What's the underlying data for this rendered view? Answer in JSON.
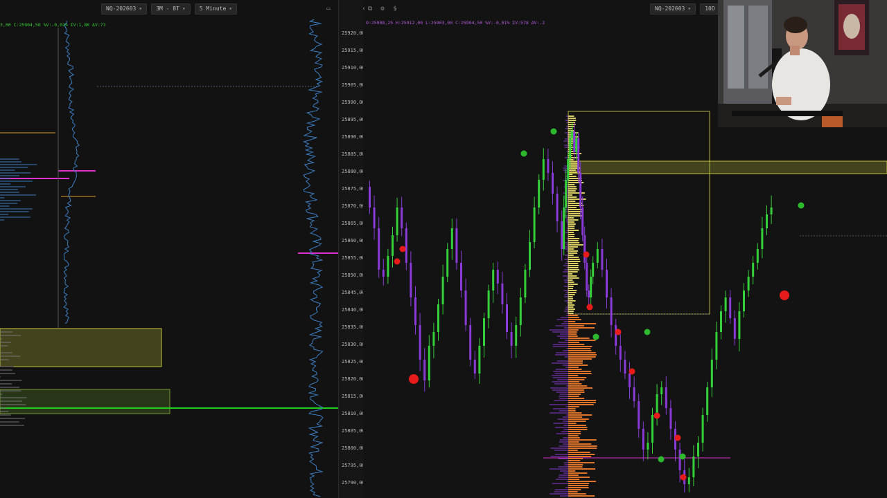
{
  "left_toolbar": {
    "symbol": "NQ-202603",
    "range": "3M - 8T",
    "interval": "5 Minute"
  },
  "left_ohlc": "3,00  C:25904,50  %V:-0,02%  ΣV:1,8K  ΔV:73",
  "right_toolbar": {
    "symbol": "NQ-202603",
    "range": "10D - 8T"
  },
  "right_ohlc": "O:25908,25  H:25912,00  L:25903,00  C:25904,50  %V:-0,01%  ΣV:578  ΔV:-2",
  "price_axis": [
    "25920,00",
    "25915,00",
    "25910,00",
    "25905,00",
    "25900,00",
    "25895,00",
    "25890,00",
    "25885,00",
    "25880,00",
    "25875,00",
    "25870,00",
    "25865,00",
    "25860,00",
    "25855,00",
    "25850,00",
    "25845,00",
    "25840,00",
    "25835,00",
    "25830,00",
    "25825,00",
    "25820,00",
    "25815,00",
    "25810,00",
    "25805,00",
    "25800,00",
    "25795,00",
    "25790,00"
  ],
  "icons": {
    "window": "window-icon",
    "minimize": "minimize-icon",
    "maximize": "maximize-icon",
    "close": "close-icon",
    "compare": "compare-icon",
    "settings": "gear-icon",
    "currency": "dollar-icon"
  },
  "colors": {
    "up": "#35d13a",
    "down": "#8a3ad6",
    "volume_profile": "#3d7fc4",
    "value_area_high": "#d8cc62",
    "value_area_low": "#e0742b",
    "marker_buy": "#2eb82e",
    "marker_sell": "#e81b1b",
    "level_magenta": "#e031d0",
    "level_green": "#1fcf1f",
    "zone": "#c2c23a"
  },
  "webcam": {
    "type": "streamer-camera-overlay"
  }
}
